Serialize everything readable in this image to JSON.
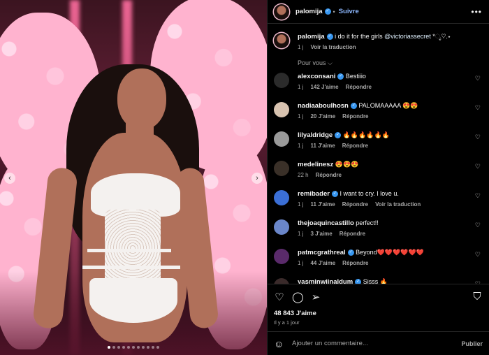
{
  "post": {
    "username": "palomija",
    "follow_label": "Suivre",
    "separator": "•",
    "more_icon": "more-horizontal-icon",
    "caption": {
      "username": "palomija",
      "text": "i do it for the girls ",
      "mention": "@victoriassecret",
      "suffix": " *ೃ♡.⋆",
      "time": "1 j",
      "translate": "Voir la traduction"
    },
    "filter_label": "Pour vous",
    "likes": "48 843 J'aime",
    "date": "Il y a 1 jour",
    "add_comment_placeholder": "Ajouter un commentaire...",
    "publish_label": "Publier",
    "carousel": {
      "slides": 11,
      "active": 0
    }
  },
  "comments": [
    {
      "username": "alexconsani",
      "verified": true,
      "text": "Bestiiio",
      "time": "1 j",
      "likes": "142 J'aime",
      "reply": "Répondre",
      "translate": "",
      "avatar_color": "#2b2b2b"
    },
    {
      "username": "nadiaaboulhosn",
      "verified": true,
      "text": "PALOMAAAAA 😍😍",
      "time": "1 j",
      "likes": "20 J'aime",
      "reply": "Répondre",
      "translate": "",
      "avatar_color": "#d8c3b0"
    },
    {
      "username": "lilyaldridge",
      "verified": true,
      "text": "🔥🔥🔥🔥🔥🔥",
      "time": "1 j",
      "likes": "11 J'aime",
      "reply": "Répondre",
      "translate": "",
      "avatar_color": "#9a9a9a"
    },
    {
      "username": "medelinesz",
      "verified": false,
      "text": "😍😍😍",
      "time": "22 h",
      "likes": "",
      "reply": "Répondre",
      "translate": "",
      "avatar_color": "#3a3028"
    },
    {
      "username": "remibader",
      "verified": true,
      "text": "I want to cry. I love u.",
      "time": "1 j",
      "likes": "11 J'aime",
      "reply": "Répondre",
      "translate": "Voir la traduction",
      "avatar_color": "#3b6fd6"
    },
    {
      "username": "thejoaquincastillo",
      "verified": false,
      "text": "perfect!!",
      "time": "1 j",
      "likes": "3 J'aime",
      "reply": "Répondre",
      "translate": "",
      "avatar_color": "#6a86c9"
    },
    {
      "username": "patmcgrathreal",
      "verified": true,
      "text": "Beyond❤️❤️❤️❤️❤️❤️",
      "time": "1 j",
      "likes": "44 J'aime",
      "reply": "Répondre",
      "translate": "",
      "avatar_color": "#5a2a6a"
    },
    {
      "username": "yasminwijnaldum",
      "verified": true,
      "text": "Sisss 🔥",
      "time": "",
      "likes": "",
      "reply": "",
      "translate": "",
      "avatar_color": "#3a2a2a"
    }
  ],
  "icons": {
    "heart": "heart-icon",
    "comment": "comment-icon",
    "share": "send-icon",
    "bookmark": "bookmark-icon",
    "emoji": "emoji-icon",
    "prev": "chevron-left-icon",
    "next": "chevron-right-icon"
  },
  "colors": {
    "background": "#000000",
    "text": "#f5f5f5",
    "muted": "#a8a8a8",
    "link": "#8eb9ff",
    "verified": "#3897f0",
    "divider": "#262626"
  }
}
